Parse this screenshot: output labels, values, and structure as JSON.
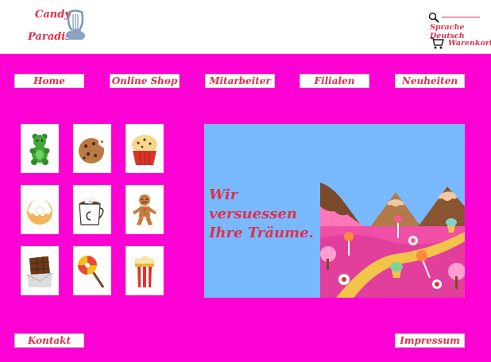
{
  "header": {
    "logo_line1": "Candy",
    "logo_line2": "Paradise",
    "language_label": "Sprache Deutsch",
    "cart_label": "Warenkorb"
  },
  "nav": {
    "items": [
      "Home",
      "Online Shop",
      "Mitarbeiter",
      "Filialen",
      "Neuheiten"
    ]
  },
  "products": {
    "icons": [
      "gummy-bear-icon",
      "cookie-icon",
      "muffin-icon",
      "donut-icon",
      "hot-chocolate-icon",
      "gingerbread-man-icon",
      "chocolate-bar-icon",
      "lollipop-icon",
      "popcorn-icon"
    ]
  },
  "hero": {
    "line1": "Wir versuessen",
    "line2": "Ihre Träume."
  },
  "footer": {
    "contact_label": "Kontakt",
    "imprint_label": "Impressum"
  },
  "colors": {
    "background": "#ff00d4",
    "accent": "#e0304a",
    "hero_sky": "#79b9ff"
  }
}
